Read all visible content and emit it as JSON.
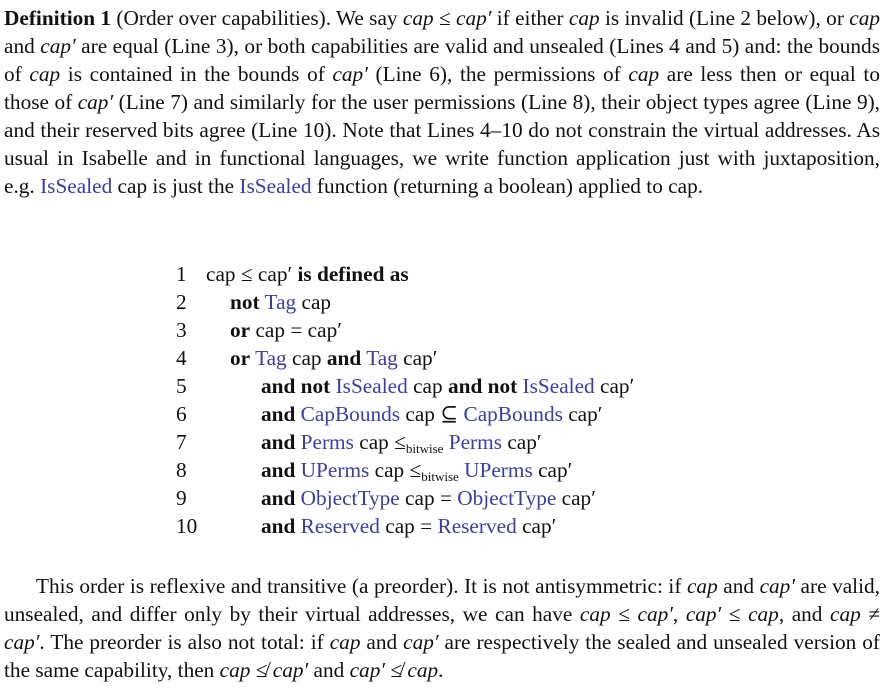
{
  "definition": {
    "label": "Definition 1",
    "title": "(Order over capabilities)."
  },
  "text": {
    "cap": "cap",
    "cap_prime": "cap′",
    "prime": "′",
    "leq": "≤",
    "neq": "≠",
    "nleq": "≰",
    "fn_issealed": "IsSealed",
    "p1": {
      "s1": " We say ",
      "s2": " if either ",
      "s3": " is invalid (Line 2 below), or ",
      "s4": " and ",
      "s5": " are equal (Line 3), or both capabilities are valid and unsealed (Lines 4 and 5) and: the bounds of ",
      "s6": " is contained in the bounds of ",
      "s7": " (Line 6), the permissions of ",
      "s8": " are less then or equal to those of ",
      "s9": " (Line 7) and similarly for the user permissions (Line 8), their object types agree (Line 9), and their reserved bits agree (Line 10). Note that Lines 4–10 do not constrain the virtual addresses. As usual in Isabelle and in functional languages, we write function application just with juxtaposition, e.g. ",
      "s10": " cap is just the ",
      "s11": " function (returning a boolean) applied to cap."
    },
    "p2": {
      "s1": "This order is reflexive and transitive (a preorder). It is not antisymmetric: if ",
      "s2": " and ",
      "s3": " are valid, unsealed, and differ only by their virtual addresses, we can have ",
      "s4": ", ",
      "s5": ", and ",
      "s6": ". The preorder is also not total: if ",
      "s7": " and ",
      "s8": " are respectively the sealed and unsealed version of the same capability, then ",
      "s9": " and ",
      "s10": "."
    }
  },
  "listing": {
    "line_numbers": [
      "1",
      "2",
      "3",
      "4",
      "5",
      "6",
      "7",
      "8",
      "9",
      "10"
    ],
    "kw": {
      "is_defined_as": "is defined as",
      "not": "not",
      "or": "or",
      "and": "and",
      "and_not": "and not"
    },
    "fn": {
      "tag": "Tag",
      "issealed": "IsSealed",
      "capbounds": "CapBounds",
      "perms": "Perms",
      "uperms": "UPerms",
      "objecttype": "ObjectType",
      "reserved": "Reserved"
    },
    "sym": {
      "cap": "cap",
      "cap_prime": "cap′",
      "leq": "≤",
      "eq": "=",
      "subseteq": "⊆",
      "leq_bitwise_base": "≤",
      "bitwise_sub": "bitwise"
    }
  }
}
